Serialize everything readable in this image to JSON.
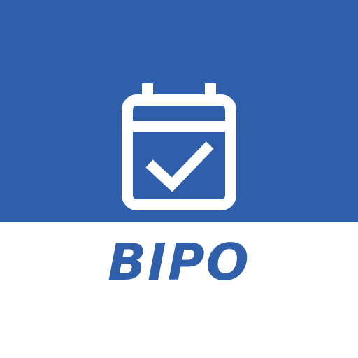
{
  "app": {
    "name": "BIPO",
    "icon": "calendar-check-icon"
  },
  "colors": {
    "brand_blue": "#2f5faa",
    "background": "#ffffff",
    "icon_stroke": "#ffffff"
  }
}
